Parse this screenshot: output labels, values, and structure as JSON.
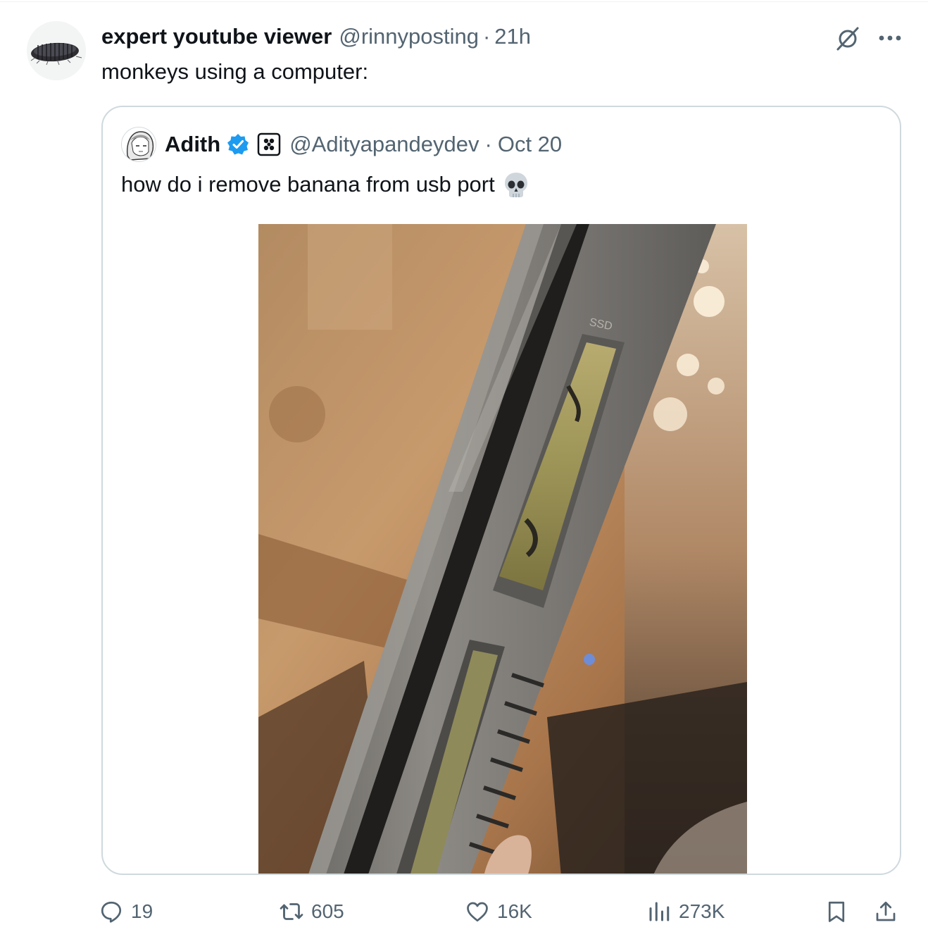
{
  "tweet": {
    "author": {
      "display_name": "expert youtube viewer",
      "handle": "@rinnyposting",
      "separator": "·",
      "time": "21h"
    },
    "text": "monkeys using a computer:"
  },
  "quote": {
    "author": {
      "display_name": "Adith",
      "handle": "@Adityapandeydev",
      "separator": "·",
      "time": "Oct 20"
    },
    "text": "how do i remove banana from usb port",
    "emoji": "skull-emoji",
    "photo_label": "SSD"
  },
  "actions": {
    "replies": "19",
    "reposts": "605",
    "likes": "16K",
    "views": "273K"
  },
  "colors": {
    "text_primary": "#0f1419",
    "text_secondary": "#536471",
    "verified": "#1d9bf0",
    "border": "#cfd9de"
  }
}
